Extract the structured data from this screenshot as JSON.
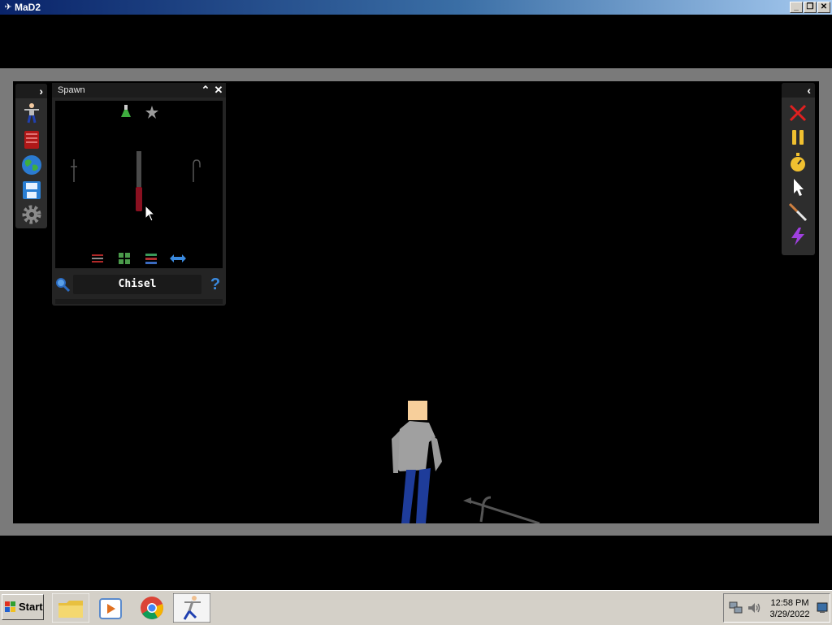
{
  "window": {
    "title": "MaD2",
    "controls": [
      "minimize-icon",
      "restore-icon",
      "close-icon"
    ]
  },
  "left_toolbar": {
    "toggle_icon": "chevron-right-icon",
    "buttons": [
      "ragdoll-icon",
      "book-icon",
      "globe-icon",
      "save-icon",
      "settings-gear-icon"
    ]
  },
  "spawn_panel": {
    "title": "Spawn",
    "category_icons": [
      "flask-icon",
      "star-icon"
    ],
    "items": [
      "dagger-icon",
      "chisel-icon",
      "hook-icon"
    ],
    "filter_icons": [
      "sliders-icon",
      "grid-icon",
      "list-icon",
      "arrows-horizontal-icon"
    ],
    "search_icon": "magnifier-icon",
    "selected_item": "Chisel",
    "help_icon": "question-icon"
  },
  "right_toolbar": {
    "toggle_icon": "chevron-left-icon",
    "buttons": [
      "clear-x-icon",
      "pause-icon",
      "stopwatch-icon",
      "pointer-icon",
      "knife-icon",
      "lightning-icon"
    ]
  },
  "taskbar": {
    "start_label": "Start",
    "apps": [
      "file-explorer-icon",
      "media-player-icon",
      "chrome-icon",
      "mad2-app-icon"
    ],
    "tray_icons": [
      "network-icon",
      "volume-icon"
    ],
    "time": "12:58 PM",
    "date": "3/29/2022",
    "show_desktop_icon": "show-desktop-icon"
  },
  "colors": {
    "titlebar_start": "#0a246a",
    "titlebar_end": "#a6caf0",
    "game_frame": "#7a7a7a",
    "panel_bg": "#242424",
    "taskbar": "#d4d0c8"
  }
}
